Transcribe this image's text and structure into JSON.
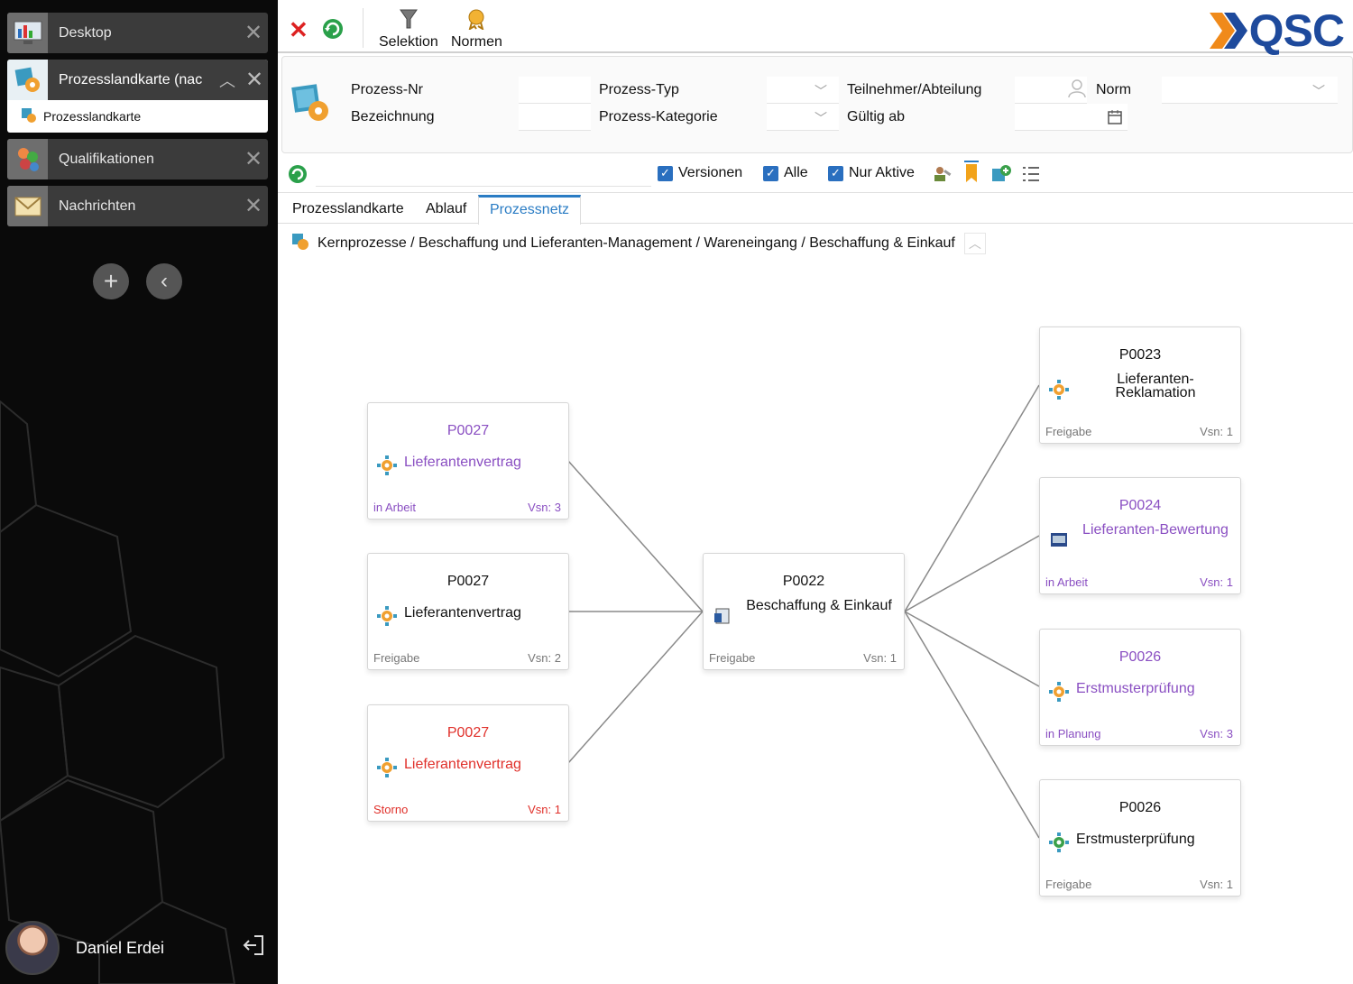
{
  "sidebar": {
    "tabs": [
      {
        "label": "Desktop",
        "icon": "desktop-chart-icon"
      },
      {
        "label": "Prozesslandkarte (nac",
        "icon": "process-map-icon",
        "sub": "Prozesslandkarte"
      },
      {
        "label": "Qualifikationen",
        "icon": "qualifications-icon"
      },
      {
        "label": "Nachrichten",
        "icon": "mail-icon"
      }
    ],
    "user_name": "Daniel Erdei"
  },
  "toolbar": {
    "selektion_label": "Selektion",
    "normen_label": "Normen",
    "logo_text": "QSC"
  },
  "filter": {
    "prozess_nr_label": "Prozess-Nr",
    "bezeichnung_label": "Bezeichnung",
    "prozess_typ_label": "Prozess-Typ",
    "prozess_kategorie_label": "Prozess-Kategorie",
    "teilnehmer_label": "Teilnehmer/Abteilung",
    "gueltig_label": "Gültig ab",
    "norm_label": "Norm"
  },
  "options": {
    "versionen": "Versionen",
    "alle": "Alle",
    "nur_aktive": "Nur Aktive"
  },
  "tabs": [
    "Prozesslandkarte",
    "Ablauf",
    "Prozessnetz"
  ],
  "breadcrumb": "Kernprozesse / Beschaffung und Lieferanten-Management / Wareneingang / Beschaffung & Einkauf",
  "colors": {
    "purple": "#8a4fc2",
    "red": "#e0302a",
    "black": "#111111",
    "accent": "#2a7cc4"
  },
  "nodes": {
    "left1": {
      "nr": "P0027",
      "name": "Lieferantenvertrag",
      "status": "in Arbeit",
      "vsn": "Vsn: 3"
    },
    "left2": {
      "nr": "P0027",
      "name": "Lieferantenvertrag",
      "status": "Freigabe",
      "vsn": "Vsn: 2"
    },
    "left3": {
      "nr": "P0027",
      "name": "Lieferantenvertrag",
      "status": "Storno",
      "vsn": "Vsn: 1"
    },
    "center": {
      "nr": "P0022",
      "name": "Beschaffung & Einkauf",
      "status": "Freigabe",
      "vsn": "Vsn: 1"
    },
    "right1": {
      "nr": "P0023",
      "name": "Lieferanten-Reklamation",
      "status": "Freigabe",
      "vsn": "Vsn: 1"
    },
    "right2": {
      "nr": "P0024",
      "name": "Lieferanten-Bewertung",
      "status": "in Arbeit",
      "vsn": "Vsn: 1"
    },
    "right3": {
      "nr": "P0026",
      "name": "Erstmusterprüfung",
      "status": "in Planung",
      "vsn": "Vsn: 3"
    },
    "right4": {
      "nr": "P0026",
      "name": "Erstmusterprüfung",
      "status": "Freigabe",
      "vsn": "Vsn: 1"
    }
  }
}
